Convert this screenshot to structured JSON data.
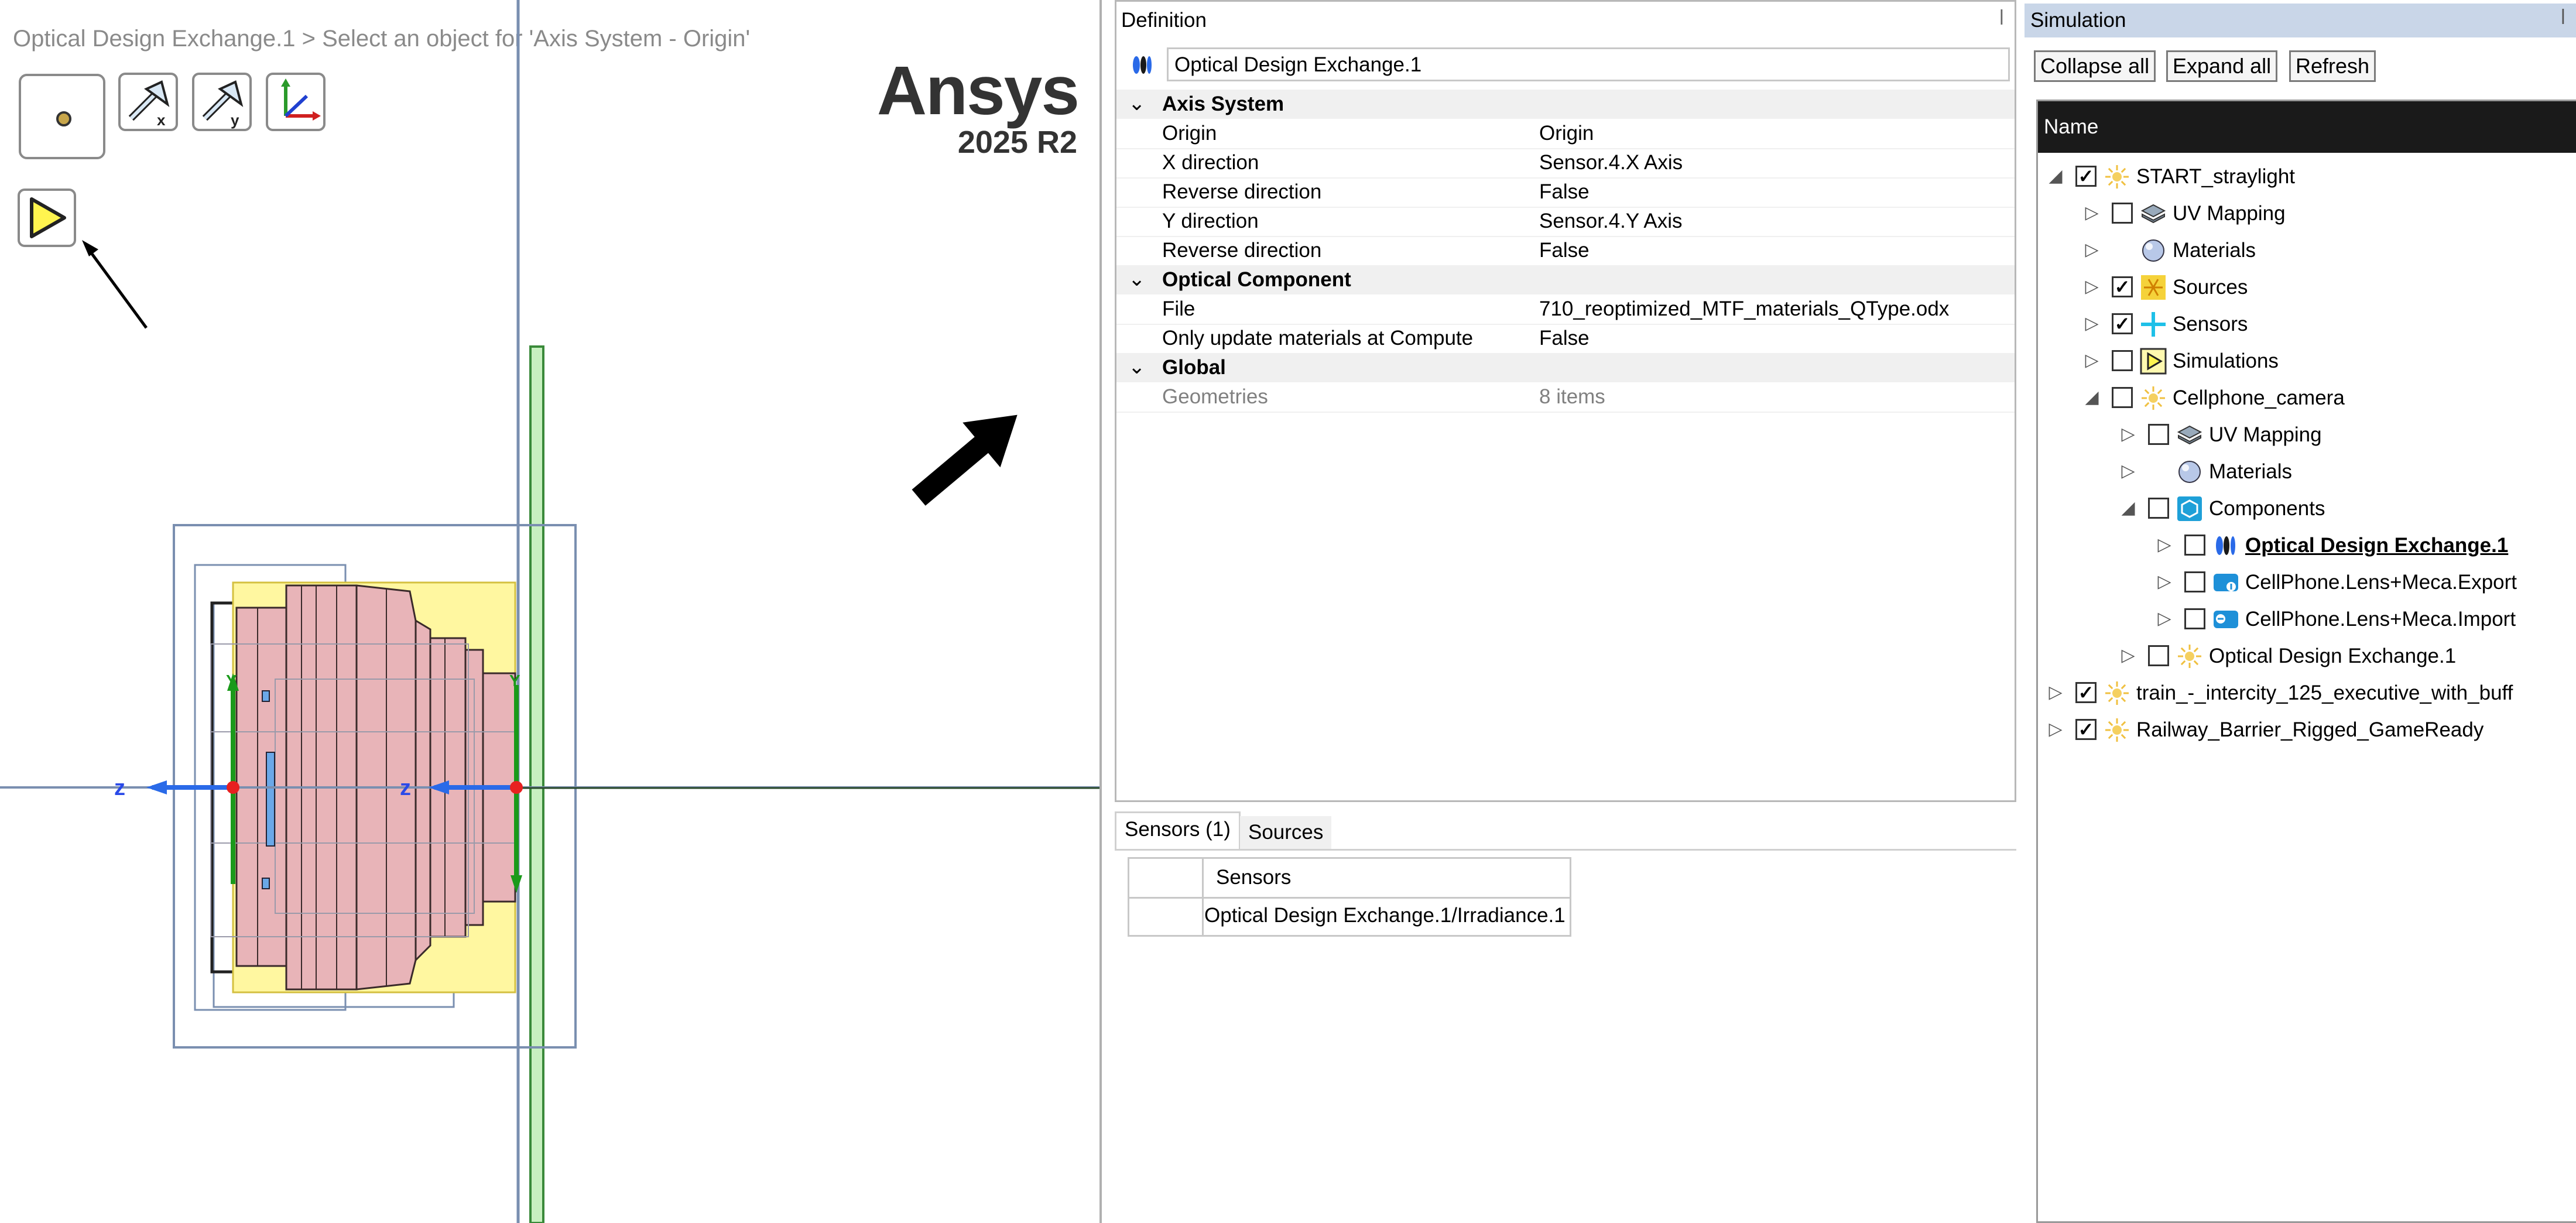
{
  "viewport": {
    "breadcrumb": "Optical Design Exchange.1 > Select an object for 'Axis System - Origin'",
    "logo_brand": "Ansys",
    "logo_version": "2025 R2",
    "axis_label_z1": "z",
    "axis_label_z2": "z",
    "axis_label_y": "Y"
  },
  "definition": {
    "panel_title": "Definition",
    "object_name": "Optical Design Exchange.1",
    "sections": [
      {
        "title": "Axis System",
        "rows": [
          {
            "name": "Origin",
            "value": "Origin"
          },
          {
            "name": "X direction",
            "value": "Sensor.4.X Axis"
          },
          {
            "name": "Reverse direction",
            "value": "False"
          },
          {
            "name": "Y direction",
            "value": "Sensor.4.Y Axis"
          },
          {
            "name": "Reverse direction",
            "value": "False"
          }
        ]
      },
      {
        "title": "Optical Component",
        "rows": [
          {
            "name": "File",
            "value": "710_reoptimized_MTF_materials_QType.odx"
          },
          {
            "name": "Only update materials at Compute",
            "value": "False"
          }
        ]
      },
      {
        "title": "Global",
        "rows": [
          {
            "name": "Geometries",
            "value": "8 items"
          }
        ]
      }
    ],
    "tabs": [
      "Sensors (1)",
      "Sources"
    ],
    "sensors_table": {
      "header": "Sensors",
      "rows": [
        "Optical Design Exchange.1/Irradiance.1"
      ]
    }
  },
  "simulation": {
    "panel_title": "Simulation",
    "buttons": {
      "collapse": "Collapse all",
      "expand": "Expand all",
      "refresh": "Refresh"
    },
    "tree_header": "Name",
    "tree": [
      {
        "label": "START_straylight",
        "checked": true,
        "expander": "◢",
        "icon": "sun-icon"
      },
      {
        "label": "UV Mapping",
        "checked": false,
        "expander": "▷",
        "icon": "uv-mapping-icon"
      },
      {
        "label": "Materials",
        "checked": null,
        "expander": "▷",
        "icon": "materials-sphere-icon"
      },
      {
        "label": "Sources",
        "checked": true,
        "expander": "▷",
        "icon": "sources-icon"
      },
      {
        "label": "Sensors",
        "checked": true,
        "expander": "▷",
        "icon": "sensors-icon"
      },
      {
        "label": "Simulations",
        "checked": false,
        "expander": "▷",
        "icon": "simulation-play-icon"
      },
      {
        "label": "Cellphone_camera",
        "checked": false,
        "expander": "◢",
        "icon": "sun-icon"
      },
      {
        "label": "UV Mapping",
        "checked": false,
        "expander": "▷",
        "icon": "uv-mapping-icon"
      },
      {
        "label": "Materials",
        "checked": null,
        "expander": "▷",
        "icon": "materials-sphere-icon"
      },
      {
        "label": "Components",
        "checked": false,
        "expander": "◢",
        "icon": "components-icon"
      },
      {
        "label": "Optical Design Exchange.1",
        "checked": false,
        "expander": "▷",
        "icon": "optical-design-icon"
      },
      {
        "label": "CellPhone.Lens+Meca.Export",
        "checked": false,
        "expander": "▷",
        "icon": "export-icon"
      },
      {
        "label": "CellPhone.Lens+Meca.Import",
        "checked": false,
        "expander": "▷",
        "icon": "import-icon"
      },
      {
        "label": "Optical Design Exchange.1",
        "checked": false,
        "expander": "▷",
        "icon": "sun-icon"
      },
      {
        "label": "train_-_intercity_125_executive_with_buff",
        "checked": true,
        "expander": "▷",
        "icon": "sun-icon"
      },
      {
        "label": "Railway_Barrier_Rigged_GameReady",
        "checked": true,
        "expander": "▷",
        "icon": "sun-icon"
      }
    ]
  },
  "colors": {
    "accent_blue": "#1e90ff",
    "selected_lens_pink": "#e8b4b8",
    "highlight_yellow": "#fff7a0",
    "sensor_green": "#c8f0c0",
    "dark_header": "#1a1a1a"
  }
}
